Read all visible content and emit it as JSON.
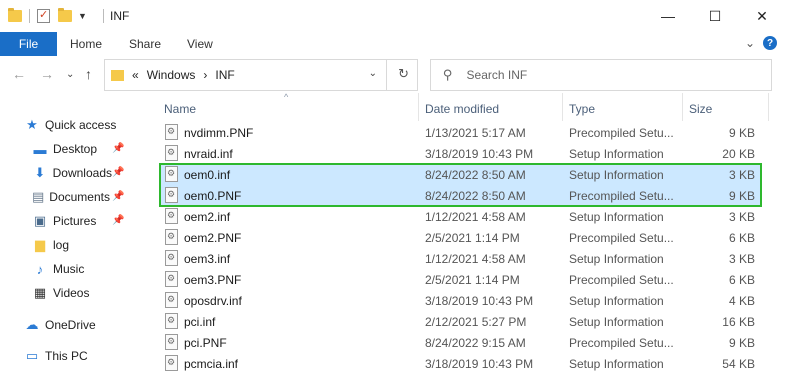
{
  "window": {
    "title": "INF",
    "minimize": "—",
    "maximize": "☐",
    "close": "✕"
  },
  "ribbon": {
    "file": "File",
    "tabs": [
      "Home",
      "Share",
      "View"
    ],
    "expand_glyph": "⌄",
    "help_glyph": "?"
  },
  "address": {
    "prefix": "«",
    "crumbs": [
      "Windows",
      "INF"
    ],
    "separator": "›",
    "back_glyph": "←",
    "forward_glyph": "→",
    "recent_glyph": "⌄",
    "up_glyph": "↑",
    "chevron": "⌄",
    "refresh_glyph": "↻"
  },
  "search": {
    "placeholder": "Search INF",
    "icon": "⚲"
  },
  "nav": {
    "items": [
      {
        "label": "Quick access",
        "icon": "star-icon",
        "glyph": "★",
        "color": "#2b7bd4"
      },
      {
        "label": "Desktop",
        "icon": "desktop-icon",
        "glyph": "▬",
        "color": "#2b7bd4",
        "pinned": true
      },
      {
        "label": "Downloads",
        "icon": "download-icon",
        "glyph": "⬇",
        "color": "#2b7bd4",
        "pinned": true
      },
      {
        "label": "Documents",
        "icon": "document-icon",
        "glyph": "▤",
        "color": "#6b7c8f",
        "pinned": true
      },
      {
        "label": "Pictures",
        "icon": "picture-icon",
        "glyph": "▣",
        "color": "#4a6b8c",
        "pinned": true
      },
      {
        "label": "log",
        "icon": "folder-icon",
        "glyph": "▆",
        "color": "#f5c94a"
      },
      {
        "label": "Music",
        "icon": "music-icon",
        "glyph": "♪",
        "color": "#2b7bd4"
      },
      {
        "label": "Videos",
        "icon": "video-icon",
        "glyph": "▦",
        "color": "#333"
      },
      {
        "label": "OneDrive",
        "icon": "cloud-icon",
        "glyph": "☁",
        "color": "#2b7bd4"
      },
      {
        "label": "This PC",
        "icon": "computer-icon",
        "glyph": "▭",
        "color": "#2b7bd4"
      }
    ],
    "pin_glyph": "📌"
  },
  "columns": {
    "name": "Name",
    "date": "Date modified",
    "type": "Type",
    "size": "Size",
    "sort_glyph": "^"
  },
  "files": [
    {
      "name": "nvdimm.PNF",
      "date": "1/13/2021 5:17 AM",
      "type": "Precompiled Setu...",
      "size": "9 KB",
      "selected": false
    },
    {
      "name": "nvraid.inf",
      "date": "3/18/2019 10:43 PM",
      "type": "Setup Information",
      "size": "20 KB",
      "selected": false
    },
    {
      "name": "oem0.inf",
      "date": "8/24/2022 8:50 AM",
      "type": "Setup Information",
      "size": "3 KB",
      "selected": true
    },
    {
      "name": "oem0.PNF",
      "date": "8/24/2022 8:50 AM",
      "type": "Precompiled Setu...",
      "size": "9 KB",
      "selected": true
    },
    {
      "name": "oem2.inf",
      "date": "1/12/2021 4:58 AM",
      "type": "Setup Information",
      "size": "3 KB",
      "selected": false
    },
    {
      "name": "oem2.PNF",
      "date": "2/5/2021 1:14 PM",
      "type": "Precompiled Setu...",
      "size": "6 KB",
      "selected": false
    },
    {
      "name": "oem3.inf",
      "date": "1/12/2021 4:58 AM",
      "type": "Setup Information",
      "size": "3 KB",
      "selected": false
    },
    {
      "name": "oem3.PNF",
      "date": "2/5/2021 1:14 PM",
      "type": "Precompiled Setu...",
      "size": "6 KB",
      "selected": false
    },
    {
      "name": "oposdrv.inf",
      "date": "3/18/2019 10:43 PM",
      "type": "Setup Information",
      "size": "4 KB",
      "selected": false
    },
    {
      "name": "pci.inf",
      "date": "2/12/2021 5:27 PM",
      "type": "Setup Information",
      "size": "16 KB",
      "selected": false
    },
    {
      "name": "pci.PNF",
      "date": "8/24/2022 9:15 AM",
      "type": "Precompiled Setu...",
      "size": "9 KB",
      "selected": false
    },
    {
      "name": "pcmcia.inf",
      "date": "3/18/2019 10:43 PM",
      "type": "Setup Information",
      "size": "54 KB",
      "selected": false
    }
  ],
  "colors": {
    "accent": "#1a6ec7",
    "selection": "#cce8ff",
    "highlight_border": "#2eb82e"
  }
}
